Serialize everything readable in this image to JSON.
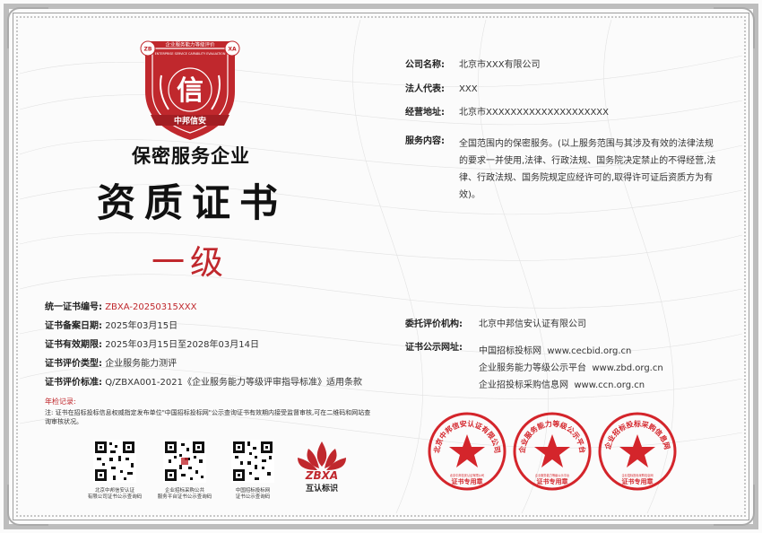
{
  "logo": {
    "top_text": "企业服务能力等级评价",
    "emblem_char": "信",
    "english": "ENTERPRISE SERVICE CAPABILITY EVALUATION",
    "ribbon": "中邦信安",
    "badge_left": "ZB",
    "badge_right": "XA"
  },
  "title": {
    "line1": "保密服务企业",
    "line2": "资质证书",
    "grade": "一级"
  },
  "left_fields": [
    {
      "label": "统一证书编号:",
      "value": "ZBXA-20250315XXX",
      "highlight": true
    },
    {
      "label": "证书备案日期:",
      "value": "2025年03月15日",
      "highlight": false
    },
    {
      "label": "证书有效期限:",
      "value": "2025年03月15日至2028年03月14日",
      "highlight": false
    },
    {
      "label": "证书评价类型:",
      "value": "企业服务能力测评",
      "highlight": false
    },
    {
      "label": "证书评价标准:",
      "value": "Q/ZBXA001-2021《企业服务能力等级评审指导标准》适用条款",
      "highlight": false
    }
  ],
  "note": {
    "title": "年检记录:",
    "text": "注: 证书在招标投标信息权威指定发布单位\"中国招标投标网\"公示查询证书有效期内接受监督审核,可在二维码和网站查询审核状况。"
  },
  "qr_codes": [
    {
      "caption1": "北京中邦信安认证",
      "caption2": "有限公司证书公示查询码"
    },
    {
      "caption1": "企业招标采购公共",
      "caption2": "服务平台证书公示查询码"
    },
    {
      "caption1": "中国招标投标网",
      "caption2": "证书公示查询码"
    }
  ],
  "zbxa_logo": {
    "letters": "ZBXA",
    "caption": "互认标识"
  },
  "right_fields": [
    {
      "label": "公司名称:",
      "value": "北京市XXX有限公司"
    },
    {
      "label": "法人代表:",
      "value": "XXX"
    },
    {
      "label": "经营地址:",
      "value": "北京市XXXXXXXXXXXXXXXXXXXX"
    }
  ],
  "scope": {
    "label": "服务内容:",
    "text": "全国范围内的保密服务。(以上服务范围与其涉及有效的法律法规的要求一并使用,法律、行政法规、国务院决定禁止的不得经营,法律、行政法规、国务院规定应经许可的,取得许可证后资质方为有效)。"
  },
  "agency": {
    "label": "委托评价机构:",
    "value": "北京中邦信安认证有限公司"
  },
  "publish": {
    "label": "证书公示网址:",
    "items": [
      {
        "name": "中国招标投标网",
        "url": "www.cecbid.org.cn"
      },
      {
        "name": "企业服务能力等级公示平台",
        "url": "www.zbd.org.cn"
      },
      {
        "name": "企业招投标采购信息网",
        "url": "www.ccn.org.cn"
      }
    ]
  },
  "seals": [
    {
      "arc": "北京中邦信安认证有限公司",
      "center": "证书专用章",
      "inner": "北京中邦信安认证有限公司"
    },
    {
      "arc": "企业服务能力等级公示平台",
      "center": "证书专用章",
      "inner": "企业服务能力等级公示平台"
    },
    {
      "arc": "企业招标投标采购信息网",
      "center": "证书专用章",
      "inner": "企业招标投标采购信息网"
    }
  ],
  "colors": {
    "red": "#c0282d",
    "text": "#222222",
    "frame": "#bdbdbd"
  }
}
